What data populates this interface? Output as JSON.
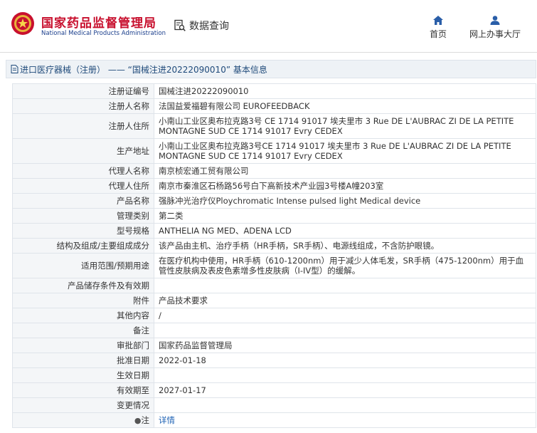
{
  "header": {
    "brand_cn": "国家药品监督管理局",
    "brand_en": "National Medical Products Administration",
    "query_label": "数据查询",
    "nav": [
      {
        "label": "首页",
        "icon": "home-icon"
      },
      {
        "label": "网上办事大厅",
        "icon": "user-icon"
      }
    ]
  },
  "title_bar": {
    "icon": "document-icon",
    "text": "进口医疗器械（注册） —— “国械注进20222090010” 基本信息"
  },
  "rows": [
    {
      "key": "注册证编号",
      "value": "国械注进20222090010"
    },
    {
      "key": "注册人名称",
      "value": "法国益爱福碧有限公司 EUROFEEDBACK"
    },
    {
      "key": "注册人住所",
      "value": "小南山工业区奥布拉克路3号 CE 1714 91017 埃夫里市 3 Rue DE L'AUBRAC ZI DE LA PETITE MONTAGNE SUD CE 1714 91017 Evry CEDEX"
    },
    {
      "key": "生产地址",
      "value": "小南山工业区奥布拉克路3号CE 1714 91017 埃夫里市 3 Rue DE L'AUBRAC ZI DE LA PETITE MONTAGNE SUD CE 1714 91017 Evry CEDEX"
    },
    {
      "key": "代理人名称",
      "value": "南京桢宏通工贸有限公司"
    },
    {
      "key": "代理人住所",
      "value": "南京市秦淮区石杨路56号白下高新技术产业园3号楼A幢203室"
    },
    {
      "key": "产品名称",
      "value": "强脉冲光治疗仪Ploychromatic Intense pulsed light Medical device"
    },
    {
      "key": "管理类别",
      "value": "第二类"
    },
    {
      "key": "型号规格",
      "value": "ANTHELIA NG MED、ADENA LCD"
    },
    {
      "key": "结构及组成/主要组成成分",
      "value": "该产品由主机、治疗手柄（HR手柄，SR手柄）、电源线组成，不含防护眼镜。"
    },
    {
      "key": "适用范围/预期用途",
      "value": "在医疗机构中使用，HR手柄（610-1200nm）用于减少人体毛发，SR手柄（475-1200nm）用于血管性皮肤病及表皮色素增多性皮肤病（I-IV型）的缓解。"
    },
    {
      "key": "产品储存条件及有效期",
      "value": ""
    },
    {
      "key": "附件",
      "value": "产品技术要求"
    },
    {
      "key": "其他内容",
      "value": "/"
    },
    {
      "key": "备注",
      "value": ""
    },
    {
      "key": "审批部门",
      "value": "国家药品监督管理局"
    },
    {
      "key": "批准日期",
      "value": "2022-01-18"
    },
    {
      "key": "生效日期",
      "value": ""
    },
    {
      "key": "有效期至",
      "value": "2027-01-17"
    },
    {
      "key": "变更情况",
      "value": ""
    }
  ],
  "note_row": {
    "key": "注",
    "icon": "bulb-icon",
    "link": "详情"
  }
}
